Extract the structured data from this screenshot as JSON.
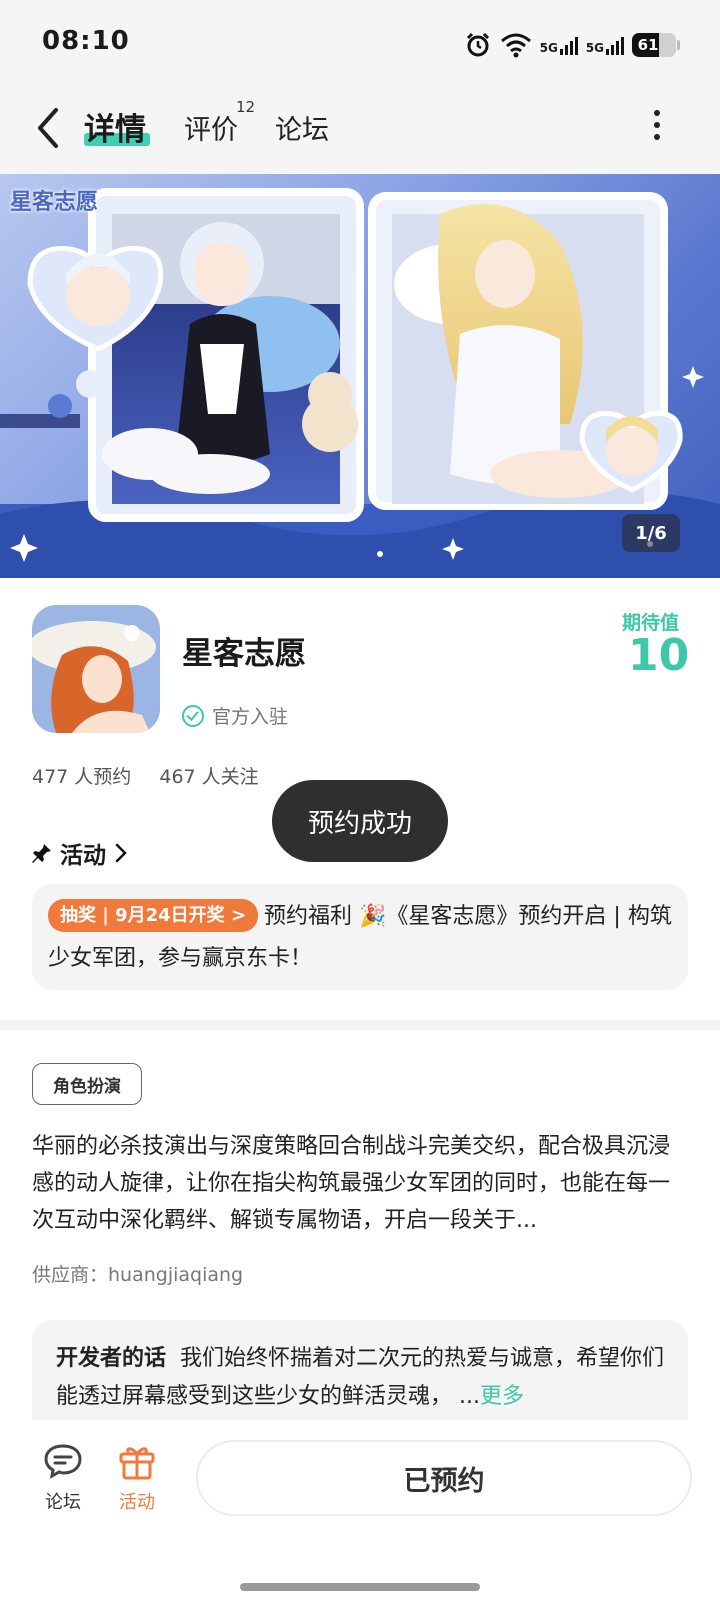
{
  "status_bar": {
    "time": "08:10",
    "network_1": "5G",
    "network_2": "5G",
    "battery": "61",
    "battery_level": 0.61
  },
  "header": {
    "tabs": [
      {
        "label": "详情",
        "active": true
      },
      {
        "label": "评价",
        "count": "12"
      },
      {
        "label": "论坛"
      }
    ]
  },
  "banner": {
    "logo_text": "星客志愿",
    "counter": "1/6"
  },
  "app": {
    "name": "星客志愿",
    "official_label": "官方入驻",
    "expect_label": "期待值",
    "expect_value": "10",
    "reservations": "477 人预约",
    "followers": "467 人关注"
  },
  "toast": "预约成功",
  "activity": {
    "heading": "活动",
    "tag": "抽奖 | 9月24日开奖 >",
    "text": "预约福利 🎉《星客志愿》预约开启 | 构筑少女军团，参与赢京东卡！"
  },
  "details": {
    "genre": "角色扮演",
    "description": "华丽的必杀技演出与深度策略回合制战斗完美交织，配合极具沉浸感的动人旋律，让你在指尖构筑最强少女军团的同时，也能在每一次互动中深化羁绊、解锁专属物语，开启一段关于...",
    "supplier": "供应商：huangjiaqiang"
  },
  "developer": {
    "title": "开发者的话",
    "text": "我们始终怀揣着对二次元的热爱与诚意，希望你们能透过屏幕感受到这些少女的鲜活灵魂，  ...",
    "more": "更多"
  },
  "bottom_bar": {
    "forum_label": "论坛",
    "activity_label": "活动",
    "reserve_button": "已预约"
  },
  "colors": {
    "accent": "#3fc7a8",
    "lottery": "#f07a3c",
    "toast_bg": "#2f2f2f"
  }
}
